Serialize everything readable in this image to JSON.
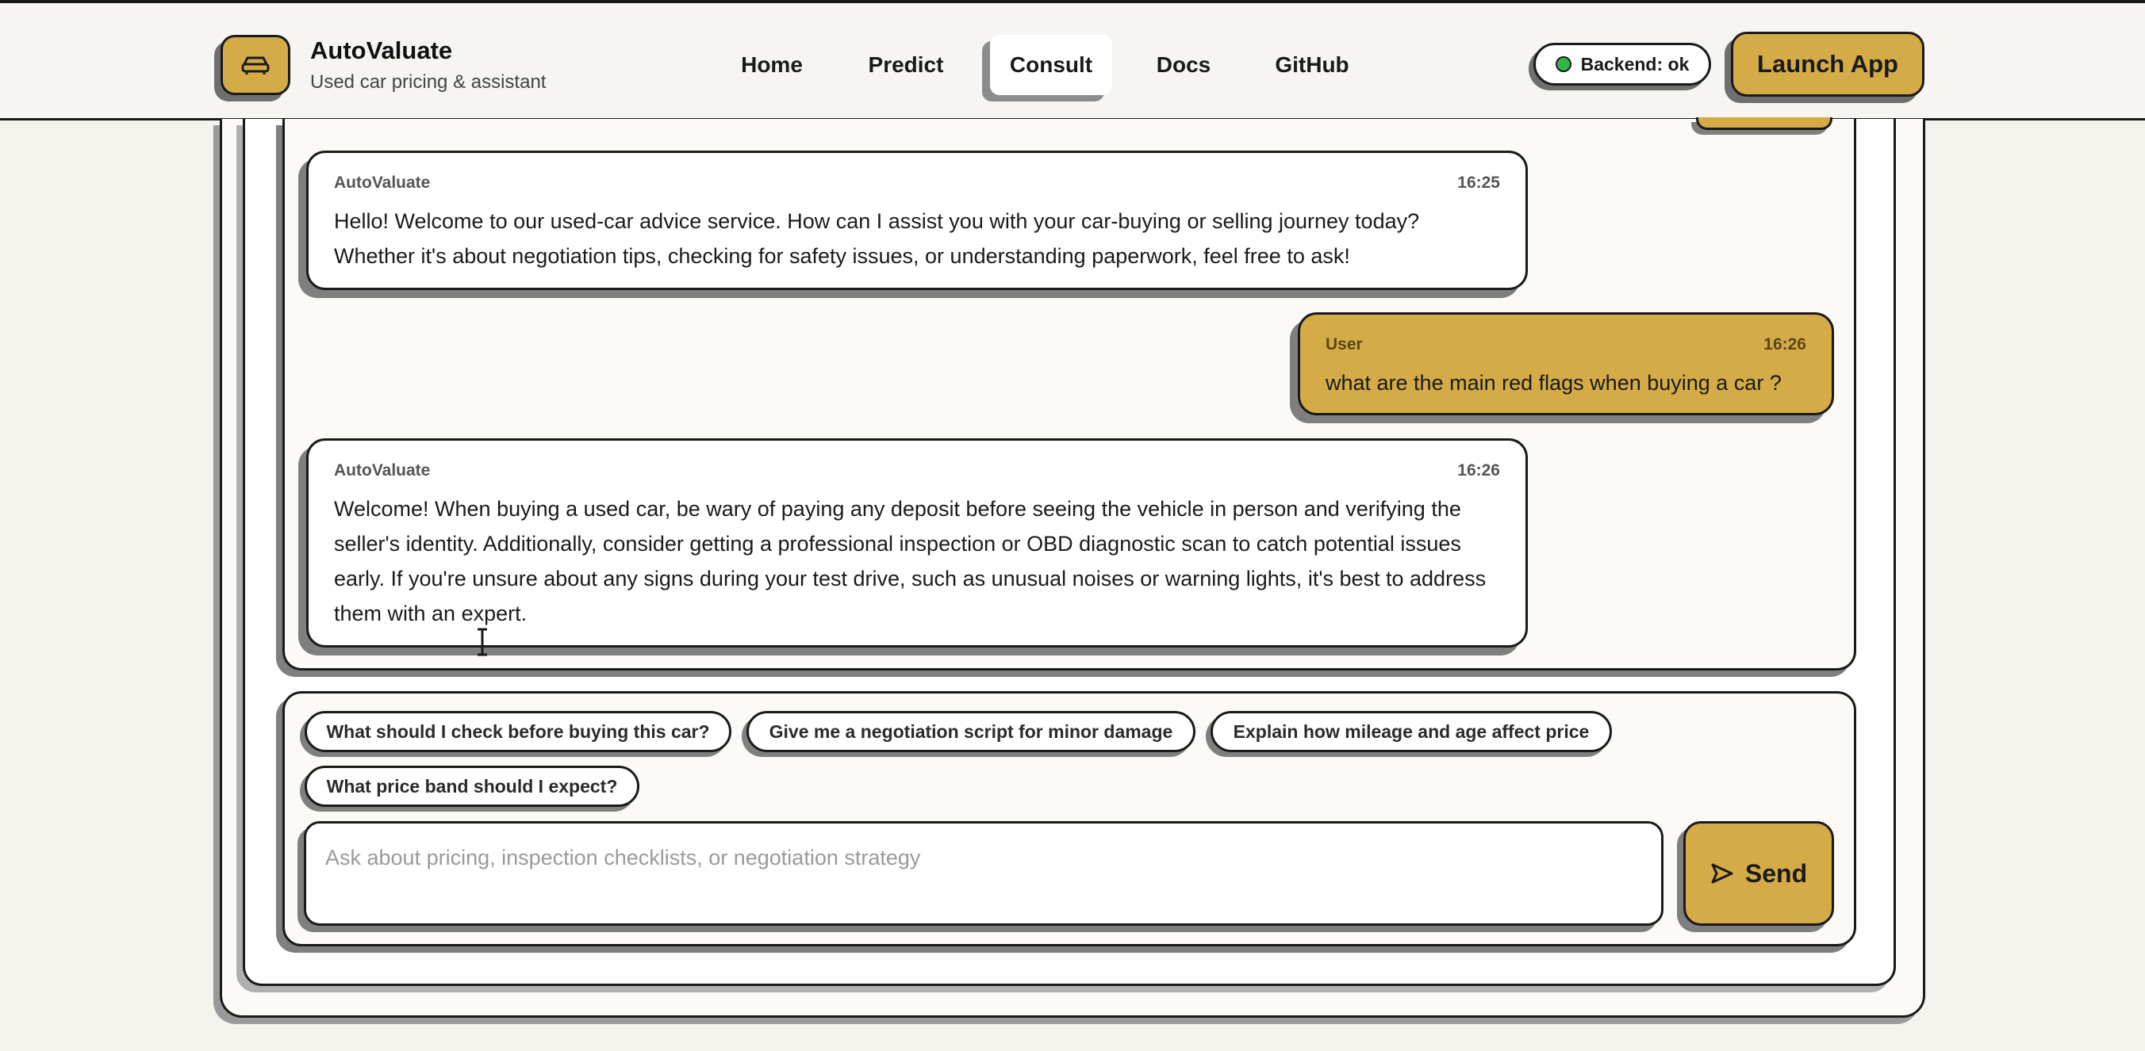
{
  "header": {
    "brand_title": "AutoValuate",
    "brand_subtitle": "Used car pricing & assistant",
    "logo_icon": "car-icon",
    "nav": [
      {
        "label": "Home",
        "active": false
      },
      {
        "label": "Predict",
        "active": false
      },
      {
        "label": "Consult",
        "active": true
      },
      {
        "label": "Docs",
        "active": false
      },
      {
        "label": "GitHub",
        "active": false
      }
    ],
    "status_label": "Backend: ok",
    "status_color": "#36b54a",
    "launch_label": "Launch App"
  },
  "chat": {
    "messages": [
      {
        "role": "bot",
        "sender": "AutoValuate",
        "time": "16:25",
        "text": "Hello! Welcome to our used-car advice service. How can I assist you with your car-buying or selling journey today? Whether it's about negotiation tips, checking for safety issues, or understanding paperwork, feel free to ask!"
      },
      {
        "role": "user",
        "sender": "User",
        "time": "16:26",
        "text": "what are the main red flags when buying a car ?"
      },
      {
        "role": "bot",
        "sender": "AutoValuate",
        "time": "16:26",
        "text": "Welcome! When buying a used car, be wary of paying any deposit before seeing the vehicle in person and verifying the seller's identity. Additionally, consider getting a professional inspection or OBD diagnostic scan to catch potential issues early. If you're unsure about any signs during your test drive, such as unusual noises or warning lights, it's best to address them with an expert."
      }
    ]
  },
  "composer": {
    "suggestions": [
      "What should I check before buying this car?",
      "Give me a negotiation script for minor damage",
      "Explain how mileage and age affect price",
      "What price band should I expect?"
    ],
    "input_value": "",
    "input_placeholder": "Ask about pricing, inspection checklists, or negotiation strategy",
    "send_label": "Send",
    "send_icon": "send-icon"
  },
  "colors": {
    "accent": "#d4ab46",
    "background": "#f4f3ee",
    "border": "#1a1a1a"
  }
}
